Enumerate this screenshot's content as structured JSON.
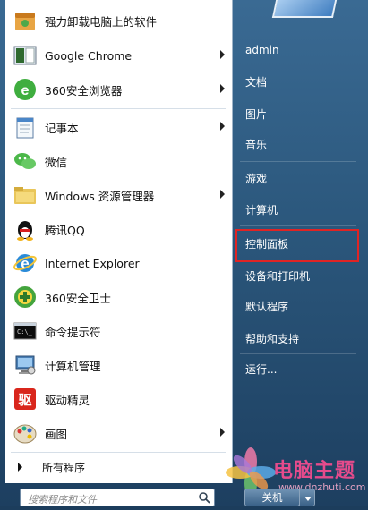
{
  "left_items": [
    {
      "label": "强力卸载电脑上的软件",
      "icon": "uninstall-box-icon",
      "submenu": false
    },
    {
      "label": "Google Chrome",
      "icon": "chrome-icon",
      "submenu": true
    },
    {
      "label": "360安全浏览器",
      "icon": "360-browser-icon",
      "submenu": true
    },
    {
      "label": "记事本",
      "icon": "notepad-icon",
      "submenu": true
    },
    {
      "label": "微信",
      "icon": "wechat-icon",
      "submenu": false
    },
    {
      "label": "Windows 资源管理器",
      "icon": "folder-icon",
      "submenu": true
    },
    {
      "label": "腾讯QQ",
      "icon": "qq-penguin-icon",
      "submenu": false
    },
    {
      "label": "Internet Explorer",
      "icon": "ie-icon",
      "submenu": false
    },
    {
      "label": "360安全卫士",
      "icon": "360-guard-icon",
      "submenu": false
    },
    {
      "label": "命令提示符",
      "icon": "cmd-icon",
      "submenu": false
    },
    {
      "label": "计算机管理",
      "icon": "computer-management-icon",
      "submenu": false
    },
    {
      "label": "驱动精灵",
      "icon": "driver-genius-icon",
      "submenu": false
    },
    {
      "label": "画图",
      "icon": "paint-palette-icon",
      "submenu": true
    }
  ],
  "all_programs": "所有程序",
  "search": {
    "placeholder": "搜索程序和文件"
  },
  "right_items": [
    {
      "label": "admin"
    },
    {
      "label": "文档"
    },
    {
      "label": "图片"
    },
    {
      "label": "音乐"
    },
    {
      "label": "游戏"
    },
    {
      "label": "计算机"
    },
    {
      "label": "控制面板",
      "highlighted": true
    },
    {
      "label": "设备和打印机"
    },
    {
      "label": "默认程序"
    },
    {
      "label": "帮助和支持"
    },
    {
      "label": "运行..."
    }
  ],
  "shutdown": {
    "label": "关机"
  },
  "watermark": {
    "title": "电脑主题",
    "url": "www.dnzhuti.com"
  },
  "colors": {
    "highlight_border": "#e02424",
    "pane_bg": "#2b577c"
  }
}
